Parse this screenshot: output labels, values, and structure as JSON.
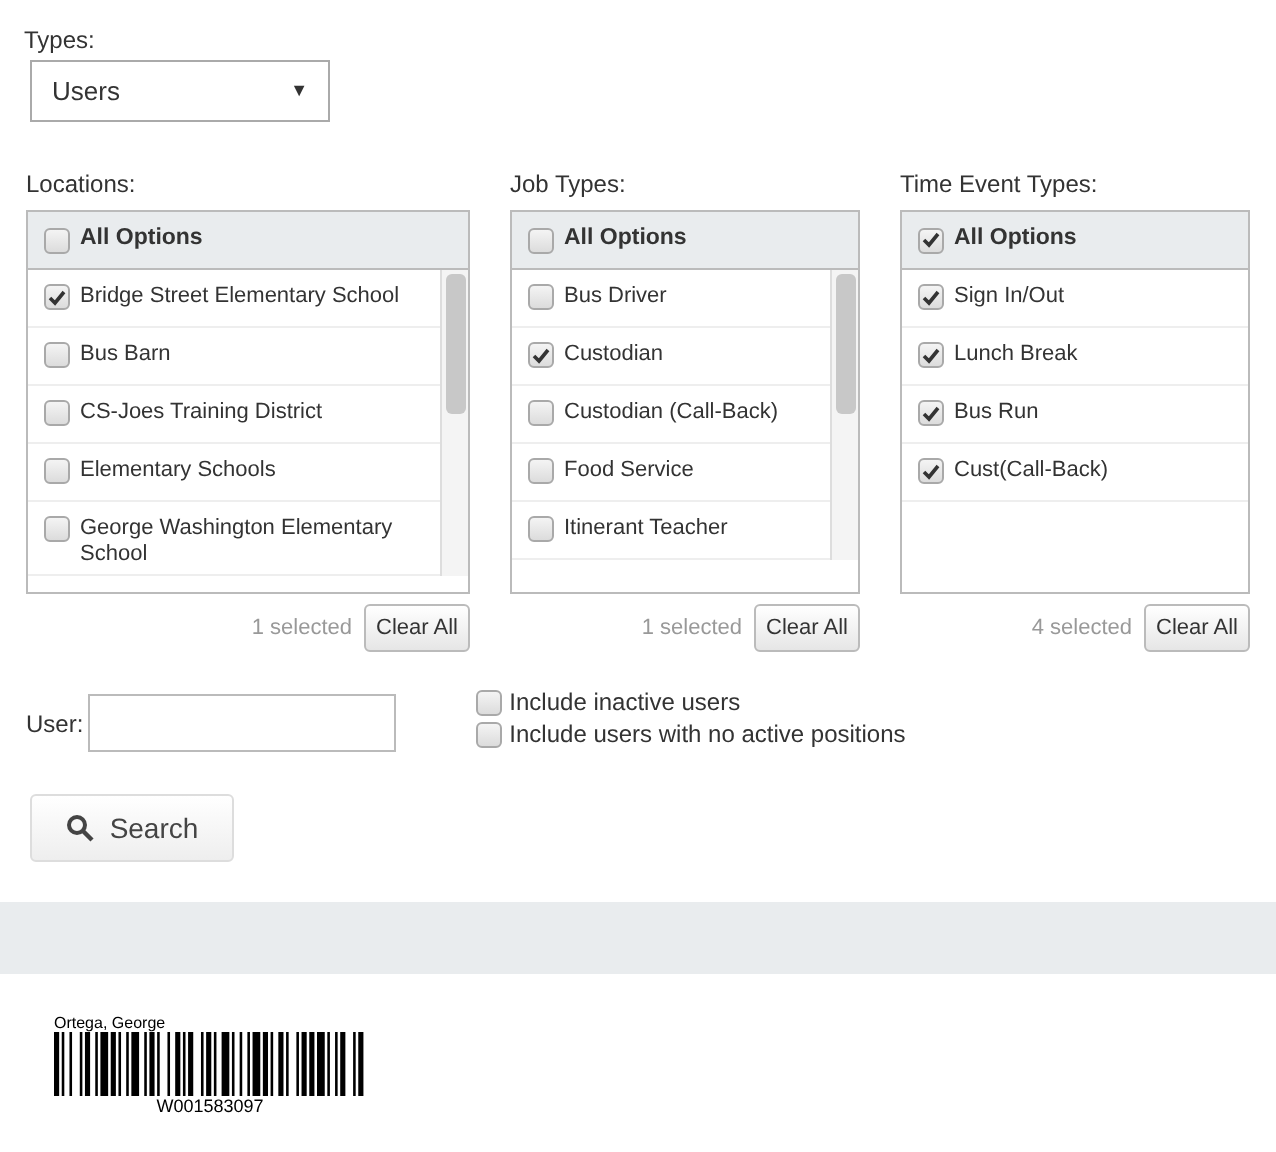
{
  "types": {
    "label": "Types:",
    "value": "Users",
    "caret": "▼"
  },
  "lists": [
    {
      "label": "Locations:",
      "all_options": {
        "label": "All Options",
        "checked": false
      },
      "scrollbar": true,
      "items": [
        {
          "label": "Bridge Street Elementary School",
          "checked": true
        },
        {
          "label": "Bus Barn",
          "checked": false
        },
        {
          "label": "CS-Joes Training District",
          "checked": false
        },
        {
          "label": "Elementary Schools",
          "checked": false
        },
        {
          "label": "George Washington Elementary School",
          "checked": false
        }
      ],
      "count": "1 selected",
      "clear": "Clear All"
    },
    {
      "label": "Job Types:",
      "all_options": {
        "label": "All Options",
        "checked": false
      },
      "scrollbar": true,
      "items": [
        {
          "label": "Bus Driver",
          "checked": false
        },
        {
          "label": "Custodian",
          "checked": true
        },
        {
          "label": "Custodian (Call-Back)",
          "checked": false
        },
        {
          "label": "Food Service",
          "checked": false
        },
        {
          "label": "Itinerant Teacher",
          "checked": false
        }
      ],
      "count": "1 selected",
      "clear": "Clear All"
    },
    {
      "label": "Time Event Types:",
      "all_options": {
        "label": "All Options",
        "checked": true
      },
      "scrollbar": false,
      "items": [
        {
          "label": "Sign In/Out",
          "checked": true
        },
        {
          "label": "Lunch Break",
          "checked": true
        },
        {
          "label": "Bus Run",
          "checked": true
        },
        {
          "label": "Cust(Call-Back)",
          "checked": true
        }
      ],
      "count": "4 selected",
      "clear": "Clear All"
    }
  ],
  "user": {
    "label": "User:"
  },
  "options": [
    {
      "label": "Include inactive users",
      "checked": false
    },
    {
      "label": "Include users with no active positions",
      "checked": false
    }
  ],
  "search_button": "Search",
  "badge": {
    "name": "Ortega, George",
    "code": "W001583097"
  }
}
